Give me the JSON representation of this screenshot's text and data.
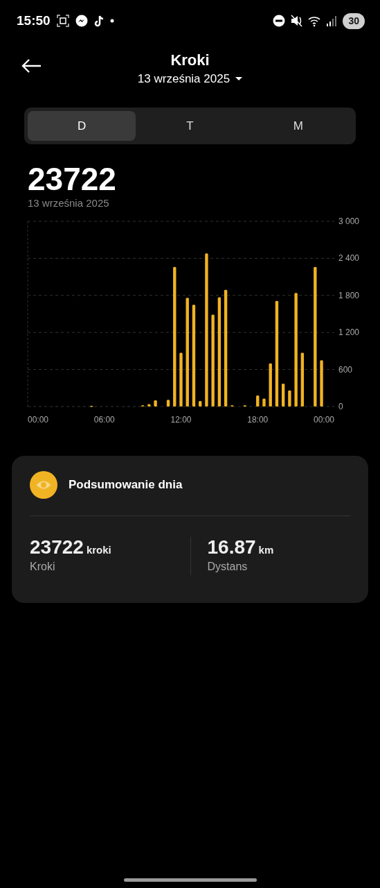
{
  "status_bar": {
    "time": "15:50",
    "battery": "30"
  },
  "header": {
    "title": "Kroki",
    "date": "13 września 2025"
  },
  "tabs": [
    {
      "label": "D",
      "selected": true
    },
    {
      "label": "T",
      "selected": false
    },
    {
      "label": "M",
      "selected": false
    }
  ],
  "total": {
    "value": "23722",
    "date": "13 września 2025"
  },
  "chart_data": {
    "type": "bar",
    "x": [
      5,
      9,
      9.5,
      10,
      11,
      11.5,
      12,
      12.5,
      13,
      13.5,
      14,
      14.5,
      15,
      15.5,
      16,
      17,
      18,
      18.5,
      19,
      19.5,
      20,
      20.5,
      21,
      21.5,
      22.5,
      23
    ],
    "grid": true,
    "series": [
      {
        "color": "#f0b323",
        "values": [
          10,
          20,
          40,
          100,
          110,
          2260,
          870,
          1760,
          1650,
          90,
          2480,
          1490,
          1770,
          1890,
          20,
          20,
          180,
          130,
          700,
          1710,
          370,
          260,
          1840,
          870,
          2260,
          750
        ]
      }
    ],
    "xlim": [
      0,
      24
    ],
    "ylim": [
      0,
      3000
    ],
    "xticks": [
      {
        "value": 0,
        "label": "00:00"
      },
      {
        "value": 6,
        "label": "06:00"
      },
      {
        "value": 12,
        "label": "12:00"
      },
      {
        "value": 18,
        "label": "18:00"
      },
      {
        "value": 24,
        "label": "00:00"
      }
    ],
    "yticks": [
      {
        "value": 0,
        "label": "0"
      },
      {
        "value": 600,
        "label": "600"
      },
      {
        "value": 1200,
        "label": "1 200"
      },
      {
        "value": 1800,
        "label": "1 800"
      },
      {
        "value": 2400,
        "label": "2 400"
      },
      {
        "value": 3000,
        "label": "3 000"
      }
    ]
  },
  "summary": {
    "title": "Podsumowanie dnia",
    "stats": [
      {
        "value": "23722",
        "unit": "kroki",
        "label": "Kroki"
      },
      {
        "value": "16.87",
        "unit": "km",
        "label": "Dystans"
      }
    ]
  }
}
